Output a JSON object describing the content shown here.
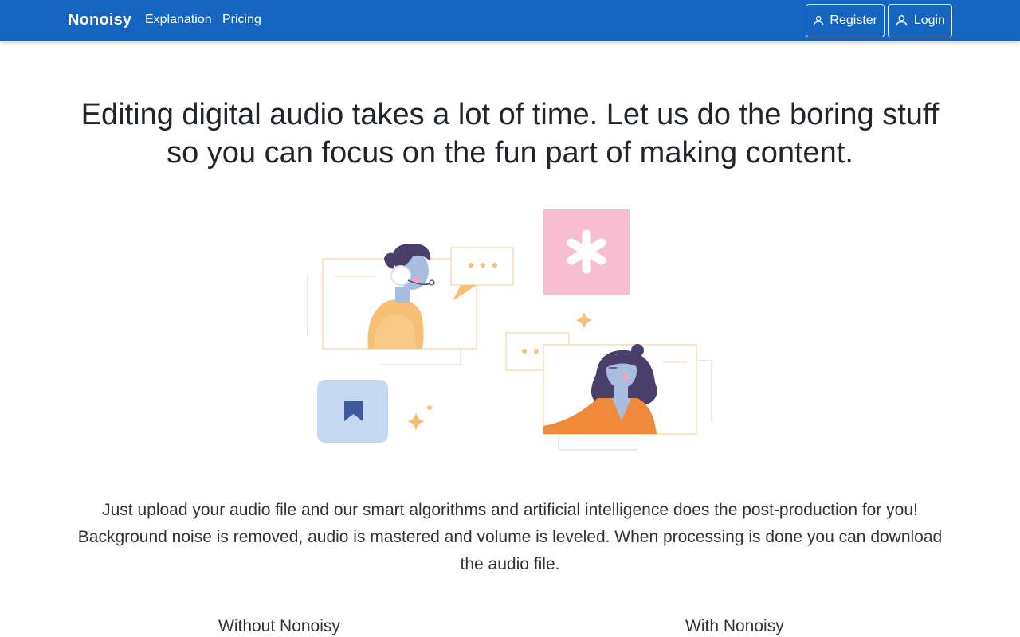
{
  "nav": {
    "brand": "Nonoisy",
    "links": [
      "Explanation",
      "Pricing"
    ],
    "register_label": "Register",
    "login_label": "Login",
    "color": "#1565c0"
  },
  "hero": {
    "headline": "Editing digital audio takes a lot of time. Let us do the boring stuff so you can focus on the fun part of making content."
  },
  "description": {
    "text": "Just upload your audio file and our smart algorithms and artificial intelligence does the post-production for you! Background noise is removed, audio is mastered and volume is leveled. When processing is done you can download the audio file."
  },
  "comparison": {
    "without_label": "Without Nonoisy",
    "with_label": "With Nonoisy"
  },
  "icons": [
    "user-icon",
    "asterisk-icon",
    "bookmark-icon",
    "sparkle-icon",
    "speech-bubble-icon"
  ]
}
